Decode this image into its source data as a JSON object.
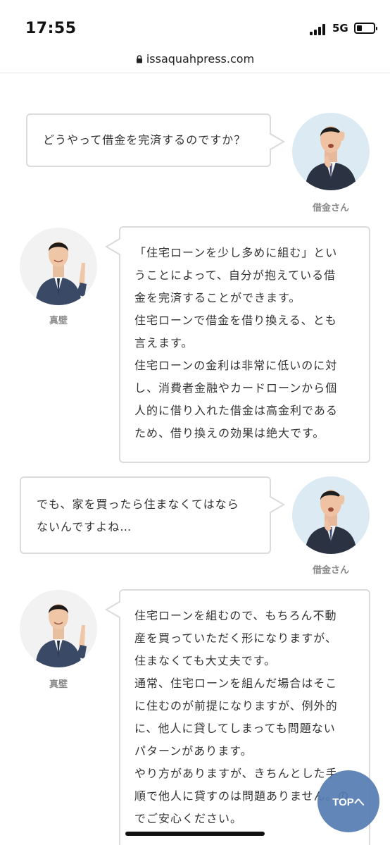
{
  "status_bar": {
    "time": "17:55",
    "network": "5G",
    "battery_level": 0.3
  },
  "browser": {
    "url": "issaquahpress.com"
  },
  "conversation": [
    {
      "speaker": "借金さん",
      "side": "right",
      "avatar": "worried-man-blue",
      "lines": [
        "どうやって借金を完済するのですか？"
      ]
    },
    {
      "speaker": "真壁",
      "side": "left",
      "avatar": "pointing-man-grey",
      "lines": [
        "「住宅ローンを少し多めに組む」とい",
        "うことによって、自分が抱えている借",
        "金を完済することができます。",
        "住宅ローンで借金を借り換える、とも",
        "言えます。",
        "住宅ローンの金利は非常に低いのに対",
        "し、消費者金融やカードローンから個",
        "人的に借り入れた借金は高金利である",
        "ため、借り換えの効果は絶大です。"
      ]
    },
    {
      "speaker": "借金さん",
      "side": "right",
      "avatar": "worried-man-blue",
      "lines": [
        "でも、家を買ったら住まなくてはなら",
        "ないんですよね…"
      ]
    },
    {
      "speaker": "真壁",
      "side": "left",
      "avatar": "pointing-man-grey",
      "lines": [
        "住宅ローンを組むので、もちろん不動",
        "産を買っていただく形になりますが、",
        "住まなくても大丈夫です。",
        "通常、住宅ローンを組んだ場合はそこ",
        "に住むのが前提になりますが、例外的",
        "に、他人に貸してしまっても問題ない",
        "パターンがあります。",
        "やり方がありますが、きちんとした手",
        "順で他人に貸すのは問題ありません。の",
        "でご安心ください。"
      ]
    }
  ],
  "top_button": {
    "label": "TOPへ"
  },
  "colors": {
    "bubble_border": "#dcdcdc",
    "top_button": "#567cb2",
    "avatar_blue_bg": "#dcebf3"
  }
}
